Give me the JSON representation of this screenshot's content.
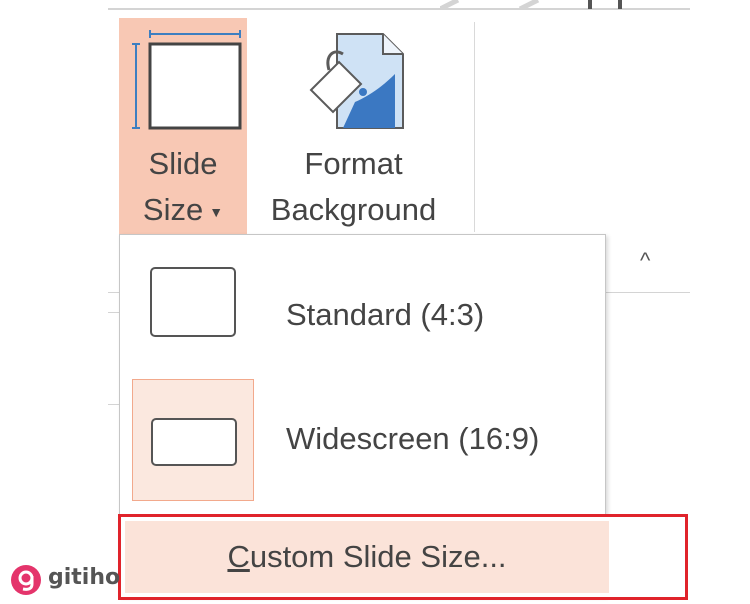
{
  "ribbon": {
    "slide_size": {
      "line1": "Slide",
      "line2": "Size",
      "icon": "slide-size-icon",
      "highlight_color": "#f8c8b4"
    },
    "format_background": {
      "line1": "Format",
      "line2": "Background",
      "icon": "format-background-icon"
    },
    "collapse_icon": "^"
  },
  "dropdown": {
    "items": [
      {
        "label": "Standard (4:3)",
        "icon": "standard-slide-thumbnail-icon"
      },
      {
        "label": "Widescreen (16:9)",
        "icon": "widescreen-slide-thumbnail-icon",
        "selected": true
      }
    ],
    "custom": {
      "accel": "C",
      "rest": "ustom Slide Size..."
    },
    "hover_color": "#fbe3d9",
    "selected_border_color": "#f2a98c",
    "callout_color": "#e0232b"
  },
  "watermark": {
    "text": "gitiho",
    "icon": "gitiho-logo-icon",
    "color": "#e4346b"
  }
}
